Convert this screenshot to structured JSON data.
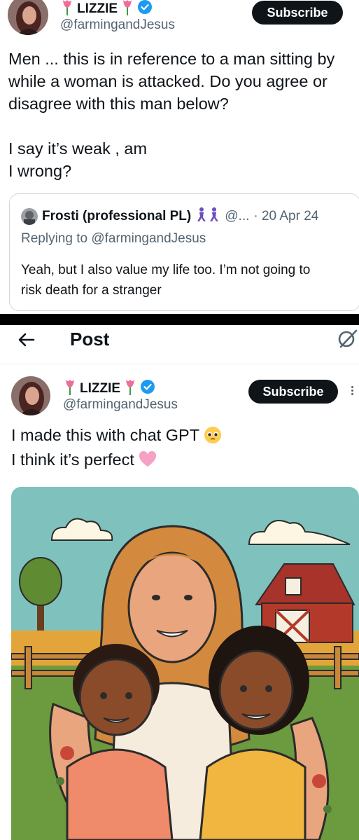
{
  "tweet1": {
    "display_name": "LIZZIE",
    "handle": "@farmingandJesus",
    "subscribe_label": "Subscribe",
    "text": "Men ... this is in reference to a man sitting by while a woman is attacked. Do you agree or disagree with this man below?\n\nI say it’s weak , am\nI wrong?"
  },
  "quote": {
    "display_name": "Frosti (professional PL)",
    "handle_truncated": "@...",
    "date": "· 20 Apr 24",
    "replying_to": "Replying to @farmingandJesus",
    "text": "Yeah, but I also value my life too. I’m not going to\nrisk death for a stranger"
  },
  "header": {
    "title": "Post",
    "back_icon": "back-arrow-icon",
    "grok_icon": "grok-icon"
  },
  "tweet2": {
    "display_name": "LIZZIE",
    "handle": "@farmingandJesus",
    "subscribe_label": "Subscribe",
    "text_line1": "I made this with chat GPT",
    "text_line2": "I think it’s perfect"
  },
  "colors": {
    "verified": "#1d9bf0",
    "subscribe_bg": "#0f1419",
    "muted": "#536471",
    "sky": "#7fc2bd",
    "barn": "#b33a2a"
  },
  "icons": [
    "tulip-emoji",
    "verified-badge-icon",
    "pleading-face-emoji",
    "pink-heart-emoji",
    "kebab-icon"
  ]
}
